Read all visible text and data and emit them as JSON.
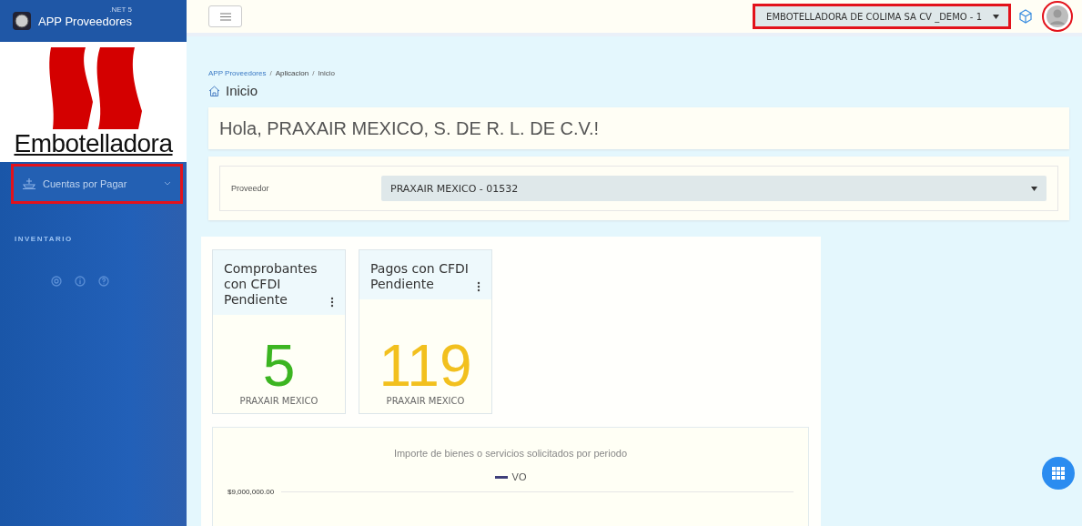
{
  "sidebar": {
    "app_name": "APP Proveedores",
    "version": ".NET 5",
    "logo_text": "Embotelladora",
    "menu": [
      {
        "label": "Cuentas por Pagar",
        "expanded": false
      }
    ],
    "section_label": "INVENTARIO"
  },
  "topbar": {
    "company_select": {
      "value": "EMBOTELLADORA DE COLIMA SA CV _DEMO - 1"
    }
  },
  "breadcrumb": {
    "separator": "/",
    "items": [
      "APP Proveedores",
      "Aplicacion",
      "Inicio"
    ]
  },
  "page_title": "Inicio",
  "greeting": "Hola, PRAXAIR MEXICO, S. DE R. L. DE C.V.!",
  "supplier_field": {
    "label": "Proveedor",
    "value": "PRAXAIR MEXICO - 01532"
  },
  "cards": [
    {
      "title": "Comprobantes con CFDI Pendiente",
      "value": "5",
      "color": "#3cb521",
      "footer": "PRAXAIR MEXICO"
    },
    {
      "title": "Pagos con CFDI Pendiente",
      "value": "119",
      "color": "#f2c01e",
      "footer": "PRAXAIR MEXICO"
    }
  ],
  "chart": {
    "title": "Importe de bienes o servicios solicitados por periodo",
    "legend": "VO",
    "y_label": "$9,000,000.00"
  }
}
